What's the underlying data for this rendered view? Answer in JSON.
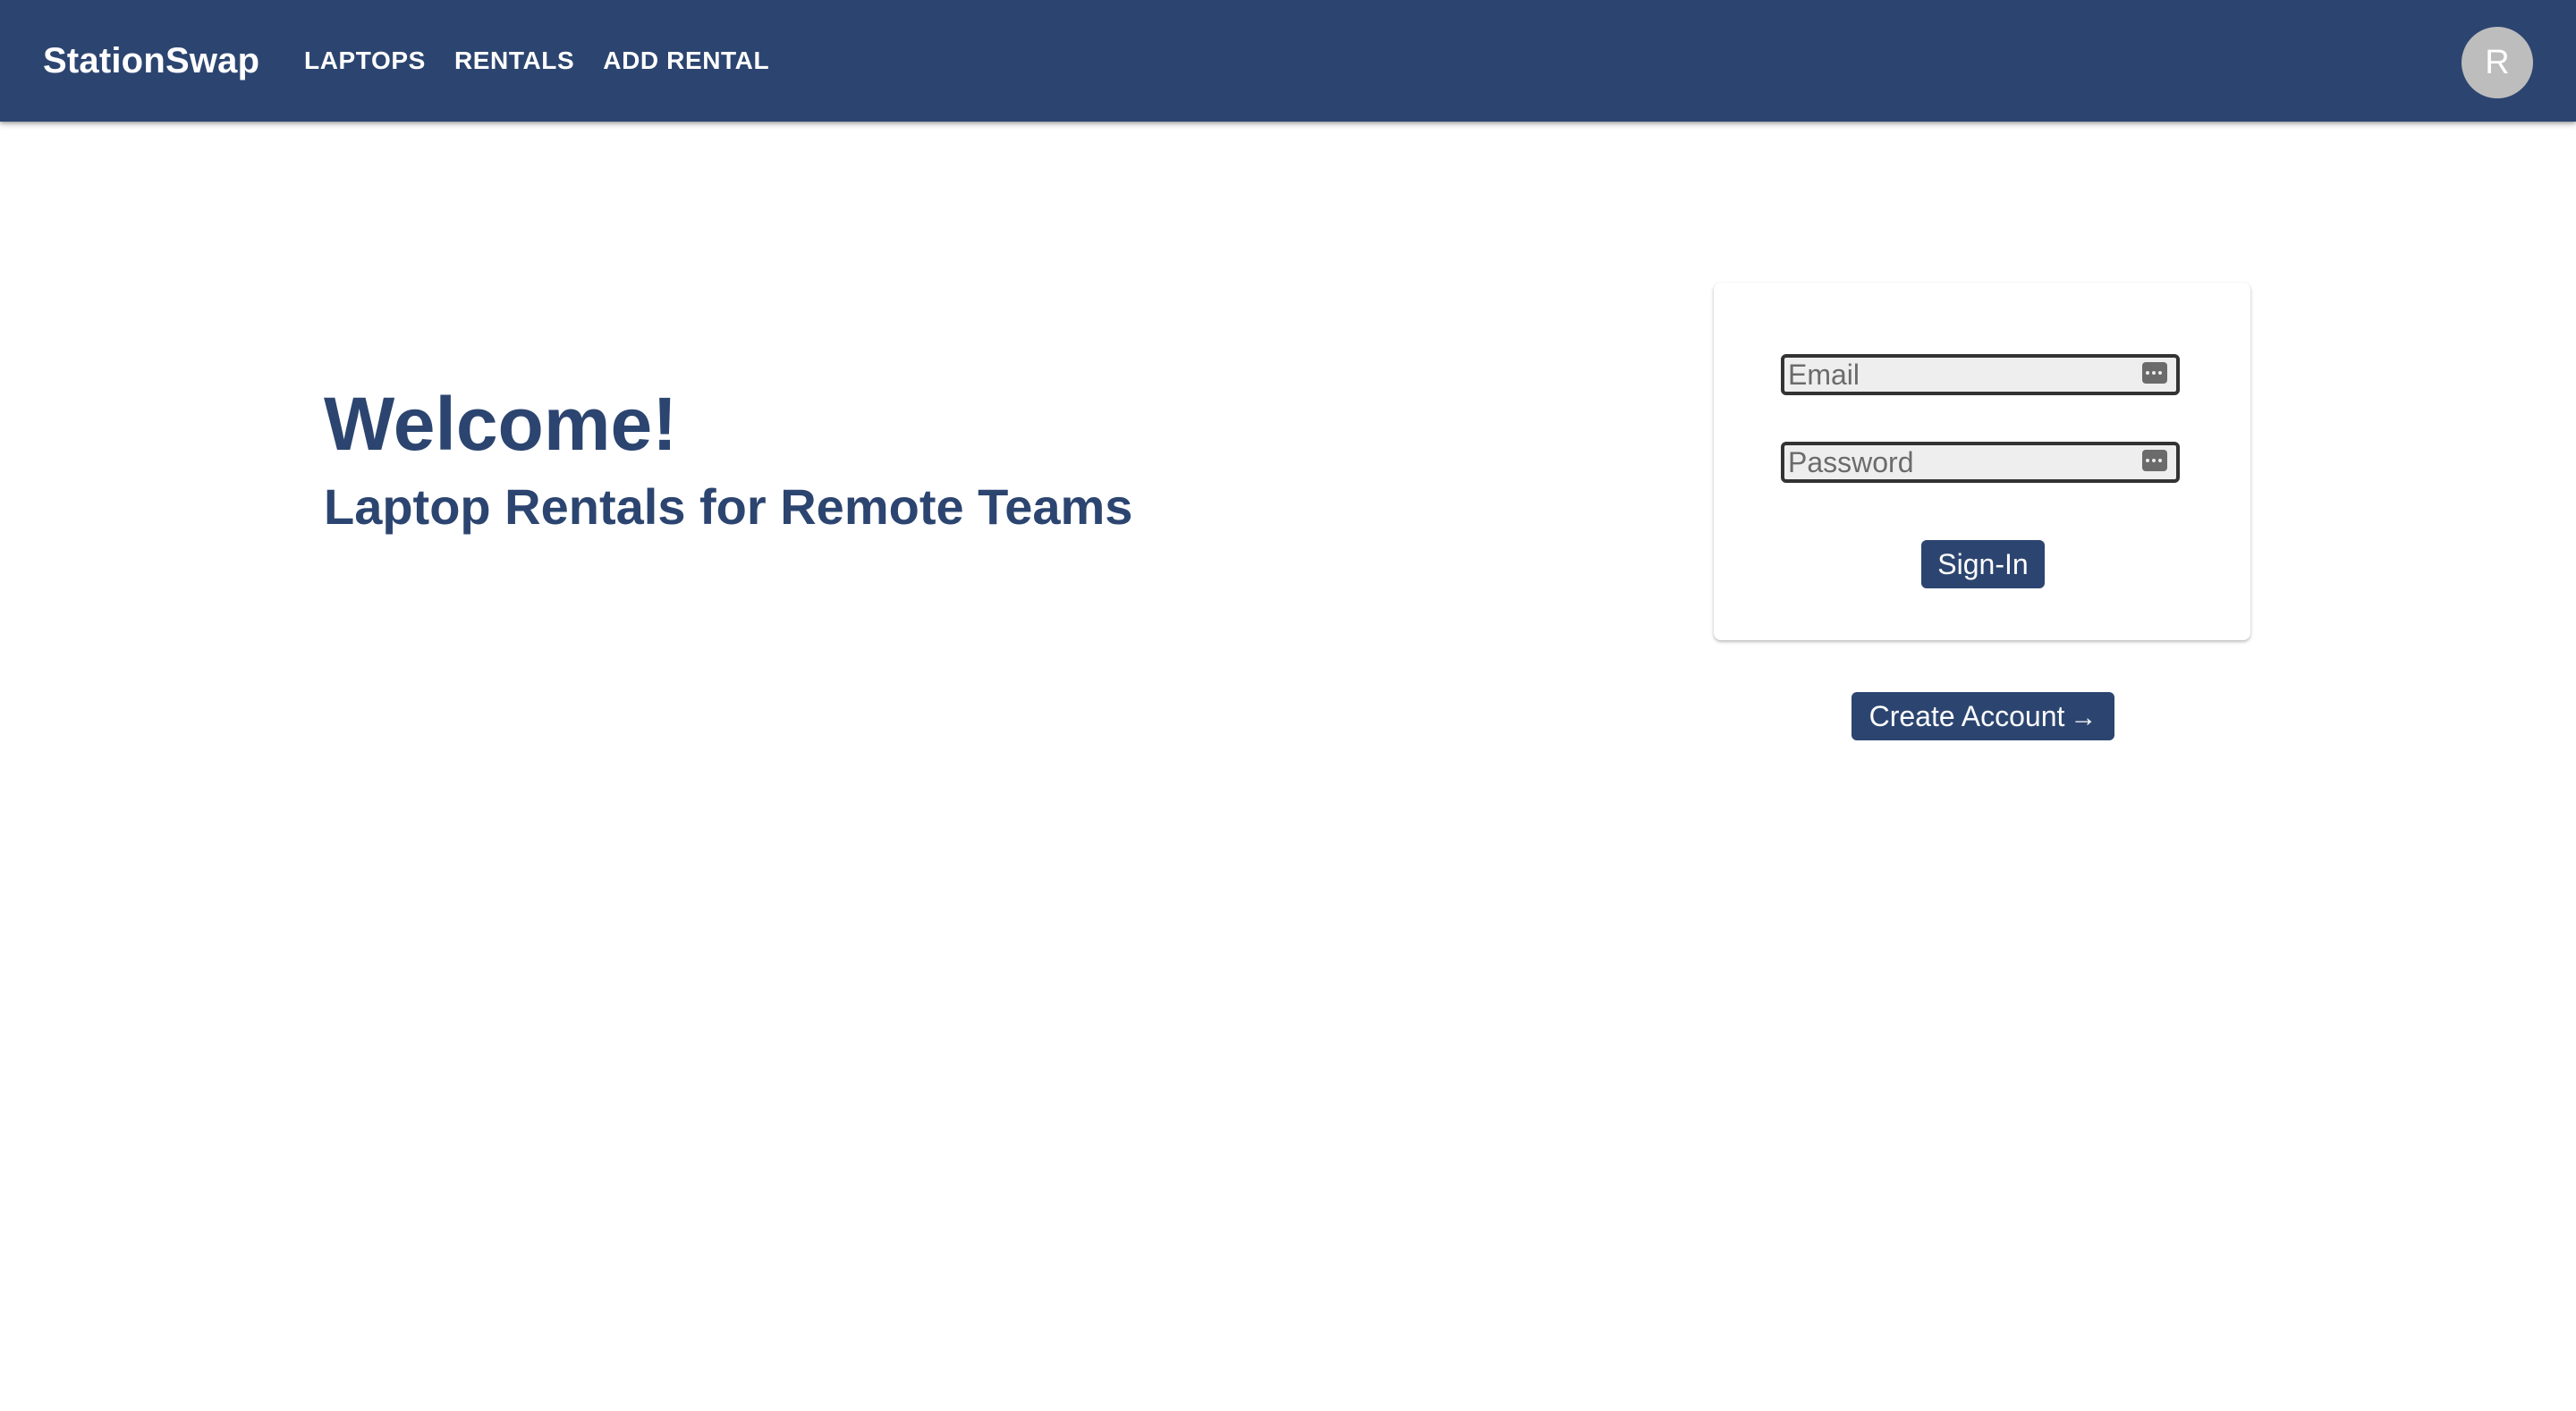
{
  "appbar": {
    "brand": "StationSwap",
    "nav": [
      {
        "label": "LAPTOPS"
      },
      {
        "label": "RENTALS"
      },
      {
        "label": "ADD RENTAL"
      }
    ],
    "avatar_initial": "R",
    "color": "#2c4570"
  },
  "hero": {
    "title": "Welcome!",
    "subtitle": "Laptop Rentals for Remote Teams"
  },
  "login": {
    "email_placeholder": "Email",
    "password_placeholder": "Password",
    "signin_label": "Sign-In",
    "autofill_icon": "password-manager-key-icon"
  },
  "create_account": {
    "label": "Create Account",
    "icon": "arrow-right-icon",
    "glyph": "→"
  }
}
